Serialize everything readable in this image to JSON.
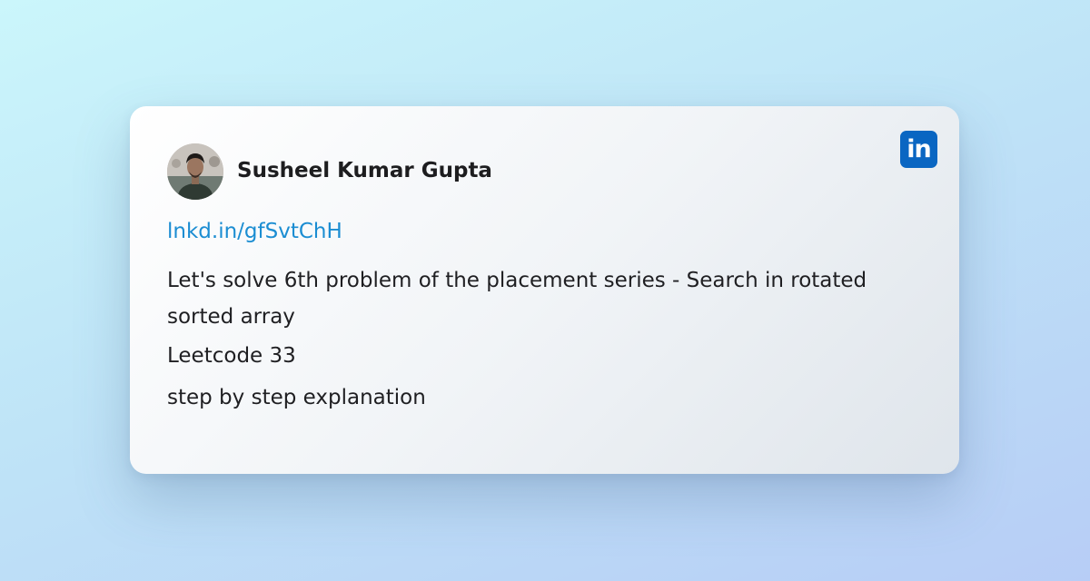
{
  "post": {
    "author": "Susheel Kumar Gupta",
    "link": "lnkd.in/gfSvtChH",
    "lines": [
      "Let's solve 6th problem of the placement series - Search in rotated sorted array",
      "Leetcode 33",
      "step by step explanation"
    ]
  },
  "icons": {
    "platform": "linkedin-icon",
    "platform_text": "in"
  },
  "colors": {
    "link": "#1b8dd2",
    "linkedin": "#0a66c2"
  }
}
